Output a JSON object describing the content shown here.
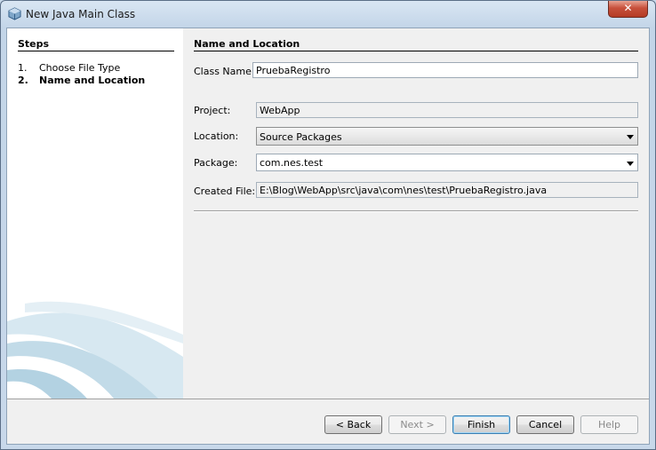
{
  "window": {
    "title": "New Java Main Class",
    "close_label": "✕"
  },
  "steps": {
    "title": "Steps",
    "items": [
      {
        "num": "1.",
        "label": "Choose File Type"
      },
      {
        "num": "2.",
        "label": "Name and Location"
      }
    ]
  },
  "panel": {
    "title": "Name and Location",
    "class_name": {
      "label": "Class Name:",
      "value": "PruebaRegistro"
    },
    "project": {
      "label": "Project:",
      "value": "WebApp"
    },
    "location": {
      "label": "Location:",
      "value": "Source Packages"
    },
    "package": {
      "label": "Package:",
      "value": "com.nes.test"
    },
    "created_file": {
      "label": "Created File:",
      "value": "E:\\Blog\\WebApp\\src\\java\\com\\nes\\test\\PruebaRegistro.java"
    }
  },
  "buttons": {
    "back": "< Back",
    "next": "Next >",
    "finish": "Finish",
    "cancel": "Cancel",
    "help": "Help"
  },
  "colors": {
    "accent": "#3c7fb1",
    "title_bar": "#c3d5e8"
  }
}
